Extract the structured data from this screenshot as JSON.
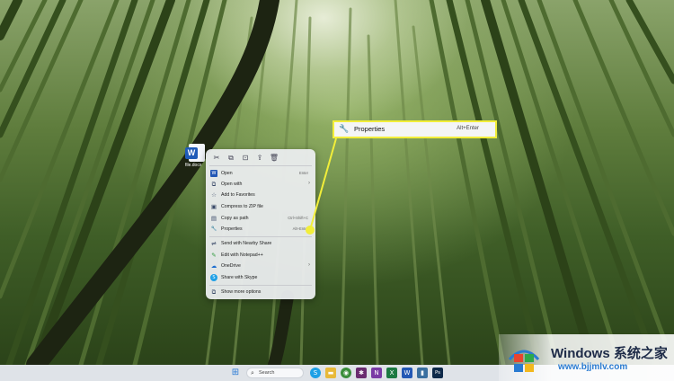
{
  "desktop": {
    "file_label": "file.docx",
    "file_badge": "W"
  },
  "context_menu": {
    "toolbar": [
      {
        "icon": "cut-icon",
        "glyph": "✂"
      },
      {
        "icon": "copy-icon",
        "glyph": "⧉"
      },
      {
        "icon": "rename-icon",
        "glyph": "⊡"
      },
      {
        "icon": "share-icon",
        "glyph": "⇪"
      },
      {
        "icon": "delete-icon",
        "glyph": "🗑"
      }
    ],
    "items": [
      {
        "label": "Open",
        "shortcut": "Enter",
        "icon": "word-icon",
        "glyph": "W"
      },
      {
        "label": "Open with",
        "shortcut": "",
        "icon": "open-with-icon",
        "glyph": "⧉",
        "submenu": "›"
      },
      {
        "label": "Add to Favorites",
        "shortcut": "",
        "icon": "star-icon",
        "glyph": "☆"
      },
      {
        "label": "Compress to ZIP file",
        "shortcut": "",
        "icon": "zip-icon",
        "glyph": "▣"
      },
      {
        "label": "Copy as path",
        "shortcut": "Ctrl+Shift+C",
        "icon": "path-icon",
        "glyph": "▤"
      },
      {
        "label": "Properties",
        "shortcut": "Alt+Enter",
        "icon": "wrench-icon",
        "glyph": "🔧"
      },
      {
        "label": "Send with Nearby Share",
        "shortcut": "",
        "icon": "nearby-share-icon",
        "glyph": "⇌"
      },
      {
        "label": "Edit with Notepad++",
        "shortcut": "",
        "icon": "notepad-icon",
        "glyph": "✎"
      },
      {
        "label": "OneDrive",
        "shortcut": "",
        "icon": "onedrive-icon",
        "glyph": "☁",
        "submenu": "›"
      },
      {
        "label": "Share with Skype",
        "shortcut": "",
        "icon": "skype-icon",
        "glyph": "S"
      },
      {
        "label": "Show more options",
        "shortcut": "",
        "icon": "more-options-icon",
        "glyph": "⧉"
      }
    ]
  },
  "callout": {
    "label": "Properties",
    "shortcut": "Alt+Enter",
    "glyph": "🔧",
    "highlight_color": "#f2ee3a"
  },
  "taskbar": {
    "search_label": "Search",
    "start_glyph": "⊞",
    "apps": [
      {
        "name": "skype",
        "glyph": "S",
        "color": "#1ea0e6"
      },
      {
        "name": "file-explorer",
        "glyph": "▬",
        "color": "#e8b93a"
      },
      {
        "name": "chrome",
        "glyph": "◉",
        "color": "#3a8d3a"
      },
      {
        "name": "slack",
        "glyph": "✱",
        "color": "#6a2c70"
      },
      {
        "name": "onenote",
        "glyph": "N",
        "color": "#7a3ba5"
      },
      {
        "name": "excel",
        "glyph": "X",
        "color": "#1d7a43"
      },
      {
        "name": "word",
        "glyph": "W",
        "color": "#2358b5"
      },
      {
        "name": "app",
        "glyph": "▮",
        "color": "#3a6fa0"
      },
      {
        "name": "photoshop",
        "glyph": "Ps",
        "color": "#0f2a4a"
      }
    ]
  },
  "watermark": {
    "title": "Windows",
    "title_cn": "系统之家",
    "url": "www.bjjmlv.com"
  }
}
